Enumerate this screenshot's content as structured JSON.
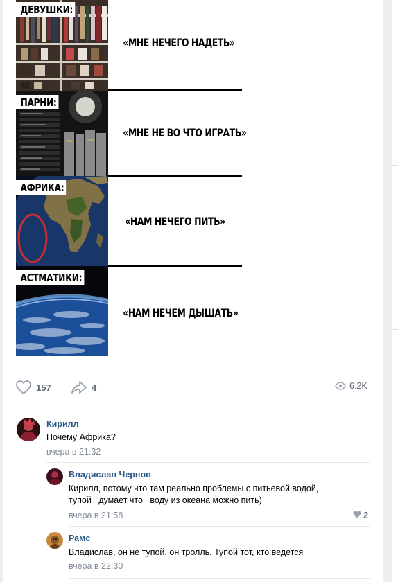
{
  "meme": {
    "panels": [
      {
        "label": "ДЕВУШКИ:",
        "quote": "«МНЕ НЕЧЕГО НАДЕТЬ»",
        "image": "wardrobe-closet"
      },
      {
        "label": "ПАРНИ:",
        "quote": "«МНЕ НЕ ВО ЧТО ИГРАТЬ»",
        "image": "video-game-stack"
      },
      {
        "label": "АФРИКА:",
        "quote": "«НАМ НЕЧЕГО ПИТЬ»",
        "image": "africa-from-space"
      },
      {
        "label": "АСТМАТИКИ:",
        "quote": "«НАМ НЕЧЕМ ДЫШАТЬ»",
        "image": "earth-atmosphere"
      }
    ]
  },
  "post_actions": {
    "likes": "157",
    "shares": "4",
    "views": "6.2K",
    "icons": {
      "like": "heart-icon",
      "share": "share-arrow-icon",
      "views": "eye-icon"
    }
  },
  "comments": [
    {
      "author": "Кирилл",
      "text": "Почему Африка?",
      "time": "вчера в 21:32",
      "replies": [
        {
          "author": "Владислав Чернов",
          "text_line1": "Кирилл, потому что там реально проблемы с питьевой водой,",
          "text_line2": "тупой   думает что   воду из океана можно пить)",
          "time": "вчера в 21:58",
          "likes": "2"
        },
        {
          "author": "Рамс",
          "text_line1": "Владислав, он не тупой, он тролль. Тупой тот, кто ведется",
          "time": "вчера в 22:30"
        }
      ]
    }
  ],
  "colors": {
    "link": "#2a5885",
    "meta": "#818c99",
    "action": "#5e6875",
    "page_bg": "#edeef0"
  }
}
